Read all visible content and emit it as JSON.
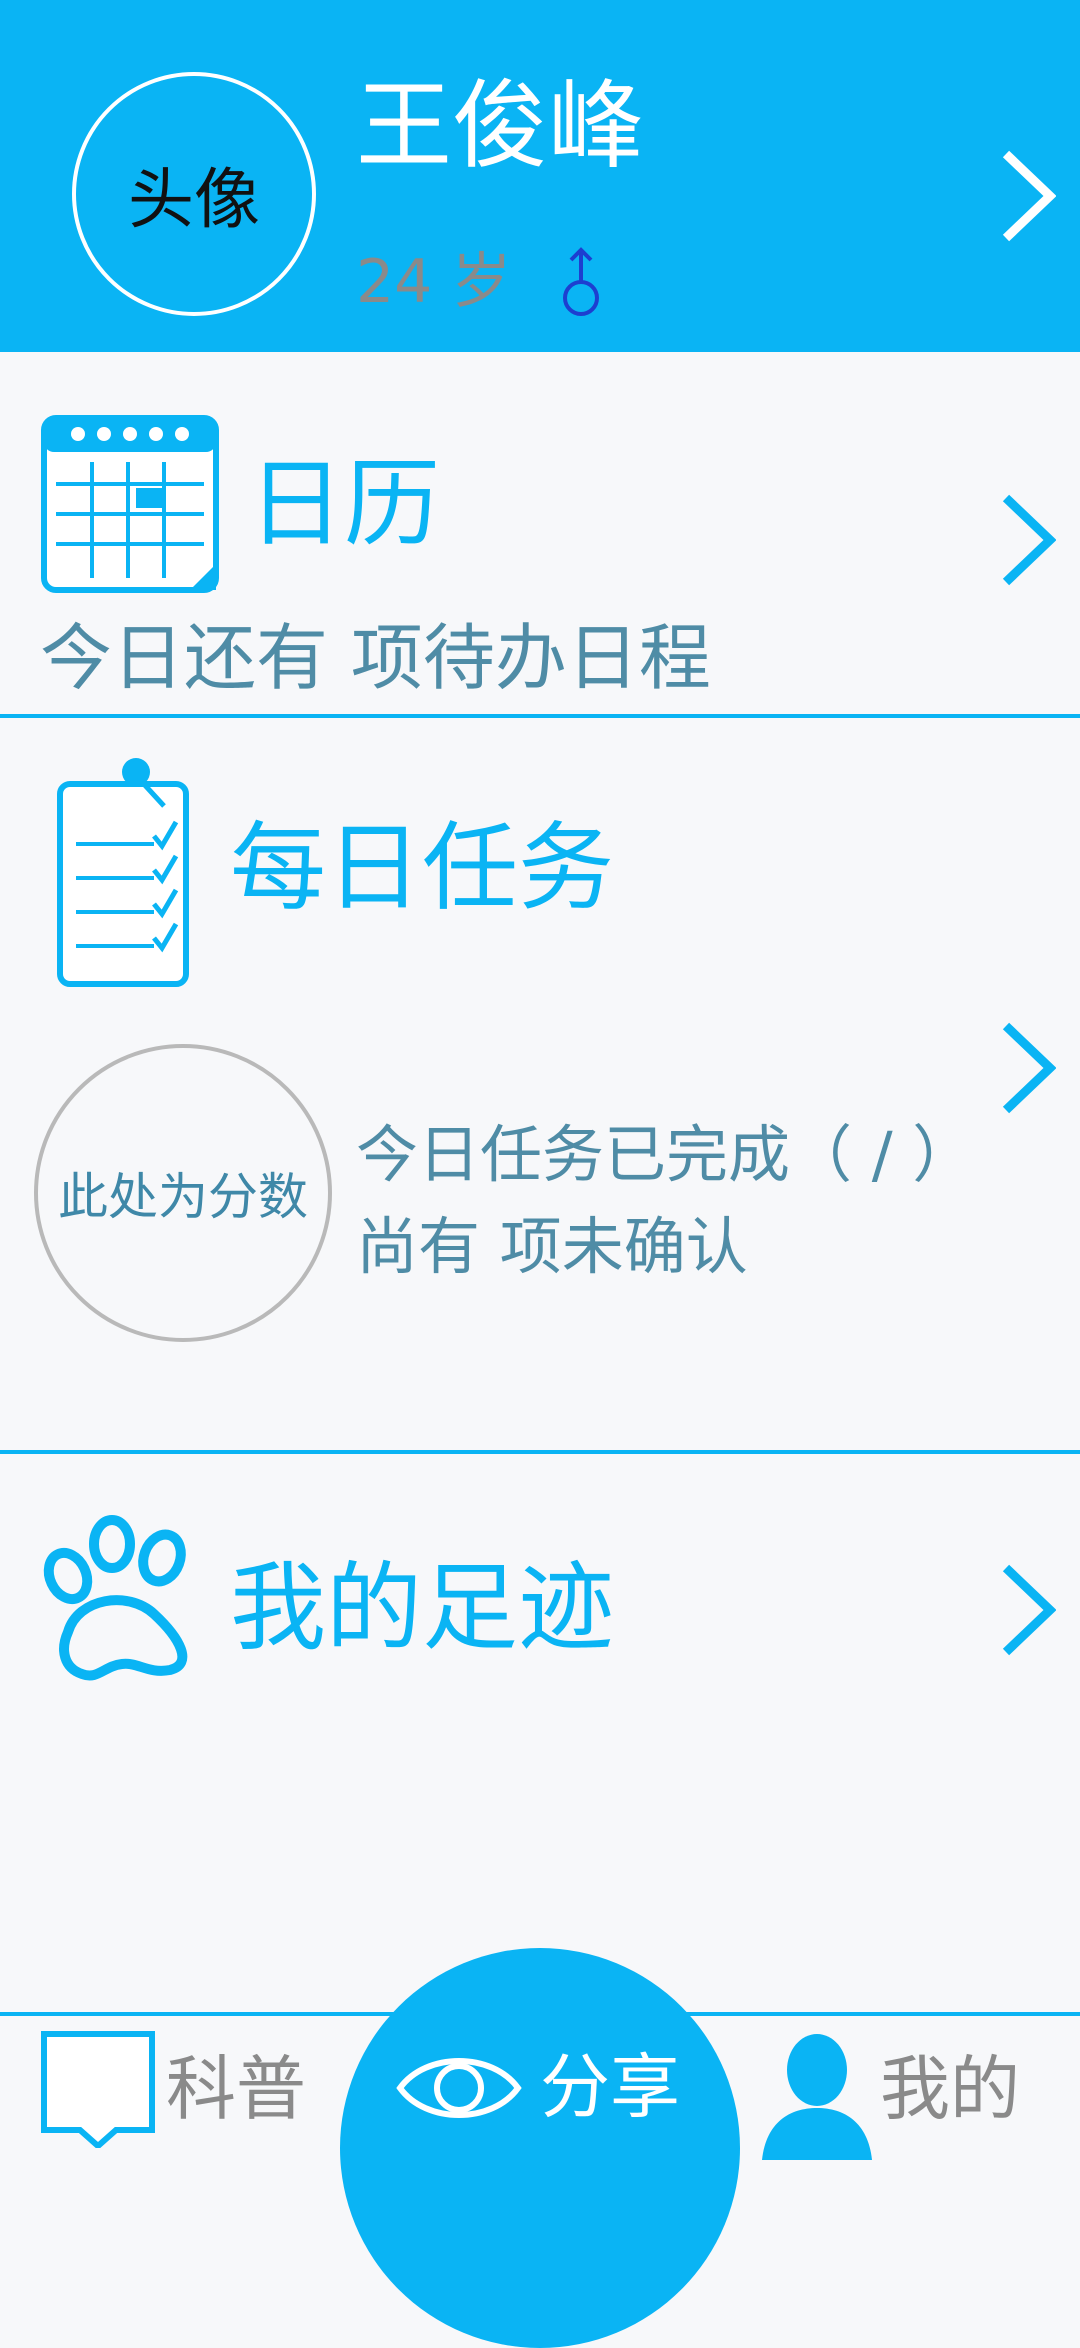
{
  "profile": {
    "avatar_label": "头像",
    "name": "王俊峰",
    "age": "24 岁",
    "gender_icon": "male-symbol-icon"
  },
  "calendar": {
    "title": "日历",
    "subtitle": "今日还有   项待办日程",
    "icon": "calendar-icon"
  },
  "tasks": {
    "title": "每日任务",
    "score_label": "此处为分数",
    "completed_line": "今日任务已完成（ / ）",
    "unconfirmed_line": "尚有  项未确认",
    "icon": "task-checklist-icon"
  },
  "footprints": {
    "title": "我的足迹",
    "icon": "paw-icon"
  },
  "nav": {
    "science_label": "科普",
    "share_label": "分享",
    "mine_label": "我的"
  },
  "colors": {
    "accent": "#0ab4f4",
    "secondary_text": "#4f8ca6",
    "age_text": "#8a8a8a",
    "gender": "#1d3fd0"
  }
}
